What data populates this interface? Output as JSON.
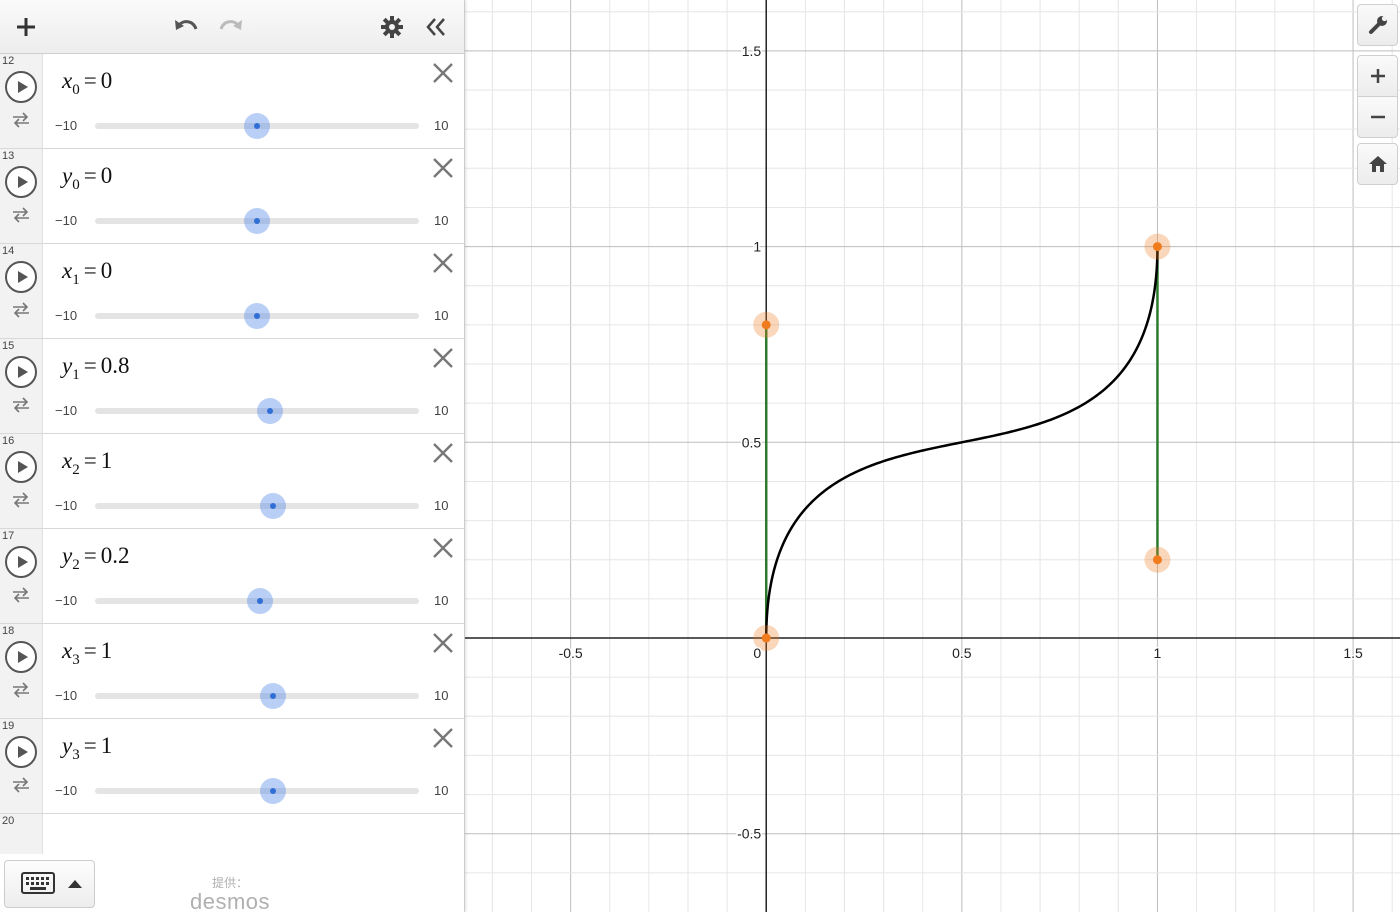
{
  "toolbar": {
    "add_icon": "plus-icon",
    "undo_icon": "undo-icon",
    "redo_icon": "redo-icon",
    "settings_icon": "gear-icon",
    "collapse_icon": "double-chevron-left-icon"
  },
  "expressions": [
    {
      "index": "12",
      "var": "x",
      "sub": "0",
      "eq": "=",
      "value": "0",
      "numeric": 0,
      "min": "−10",
      "max": "10"
    },
    {
      "index": "13",
      "var": "y",
      "sub": "0",
      "eq": "=",
      "value": "0",
      "numeric": 0,
      "min": "−10",
      "max": "10"
    },
    {
      "index": "14",
      "var": "x",
      "sub": "1",
      "eq": "=",
      "value": "0",
      "numeric": 0,
      "min": "−10",
      "max": "10"
    },
    {
      "index": "15",
      "var": "y",
      "sub": "1",
      "eq": "=",
      "value": "0.8",
      "numeric": 0.8,
      "min": "−10",
      "max": "10"
    },
    {
      "index": "16",
      "var": "x",
      "sub": "2",
      "eq": "=",
      "value": "1",
      "numeric": 1,
      "min": "−10",
      "max": "10"
    },
    {
      "index": "17",
      "var": "y",
      "sub": "2",
      "eq": "=",
      "value": "0.2",
      "numeric": 0.2,
      "min": "−10",
      "max": "10"
    },
    {
      "index": "18",
      "var": "x",
      "sub": "3",
      "eq": "=",
      "value": "1",
      "numeric": 1,
      "min": "−10",
      "max": "10"
    },
    {
      "index": "19",
      "var": "y",
      "sub": "3",
      "eq": "=",
      "value": "1",
      "numeric": 1,
      "min": "−10",
      "max": "10"
    }
  ],
  "empty_expression": {
    "index": "20"
  },
  "footer": {
    "keyboard_icon": "keyboard-icon",
    "brand_top": "提供：",
    "brand_logo": "desmos"
  },
  "graph_controls": {
    "settings_icon": "wrench-icon",
    "zoom_in_icon": "plus-icon",
    "zoom_out_icon": "minus-icon",
    "home_icon": "home-icon"
  },
  "chart_data": {
    "type": "line",
    "xlim": [
      -0.77,
      1.62
    ],
    "ylim": [
      -0.7,
      1.63
    ],
    "grid": true,
    "x_ticks": [
      {
        "value": -0.5,
        "label": "-0.5"
      },
      {
        "value": 0,
        "label": "0"
      },
      {
        "value": 0.5,
        "label": "0.5"
      },
      {
        "value": 1,
        "label": "1"
      },
      {
        "value": 1.5,
        "label": "1.5"
      }
    ],
    "y_ticks": [
      {
        "value": -0.5,
        "label": "-0.5"
      },
      {
        "value": 0.5,
        "label": "0.5"
      },
      {
        "value": 1,
        "label": "1"
      },
      {
        "value": 1.5,
        "label": "1.5"
      }
    ],
    "control_points": [
      {
        "x": 0,
        "y": 0
      },
      {
        "x": 0,
        "y": 0.8
      },
      {
        "x": 1,
        "y": 0.2
      },
      {
        "x": 1,
        "y": 1
      }
    ],
    "handle_segments": [
      {
        "from": [
          0,
          0
        ],
        "to": [
          0,
          0.8
        ]
      },
      {
        "from": [
          1,
          0.2
        ],
        "to": [
          1,
          1
        ]
      }
    ],
    "curve_color": "#000000",
    "handle_color": "#2d7a2d",
    "point_color": "#f07c1e"
  }
}
